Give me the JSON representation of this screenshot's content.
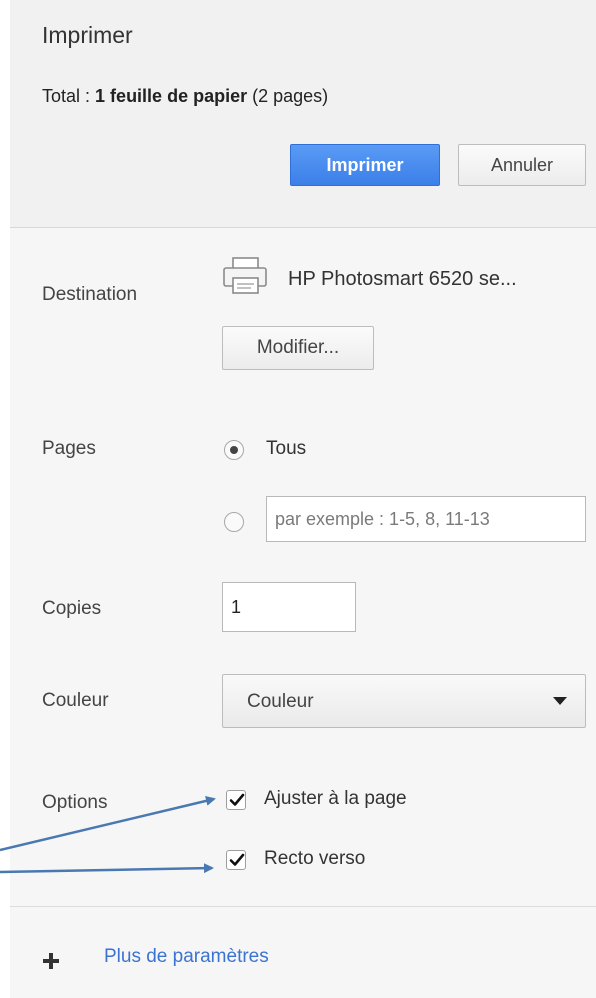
{
  "header": {
    "title": "Imprimer",
    "total_prefix": "Total :",
    "total_bold": "1 feuille de papier",
    "total_suffix": "(2 pages)",
    "print_label": "Imprimer",
    "cancel_label": "Annuler"
  },
  "destination": {
    "label": "Destination",
    "printer_name": "HP Photosmart 6520 se...",
    "icon": "printer-icon",
    "change_label": "Modifier..."
  },
  "pages": {
    "label": "Pages",
    "all_label": "Tous",
    "all_selected": true,
    "range_placeholder": "par exemple : 1-5, 8, 11-13"
  },
  "copies": {
    "label": "Copies",
    "value": "1"
  },
  "color": {
    "label": "Couleur",
    "selected": "Couleur"
  },
  "options": {
    "label": "Options",
    "items": [
      {
        "label": "Ajuster à la page",
        "checked": true
      },
      {
        "label": "Recto verso",
        "checked": true
      }
    ]
  },
  "more_settings": {
    "label": "Plus de paramètres",
    "icon": "plus-icon"
  },
  "colors": {
    "primary_button": "#3b7fe9",
    "link": "#3b73d1",
    "annotation_arrow": "#4a78b0"
  }
}
